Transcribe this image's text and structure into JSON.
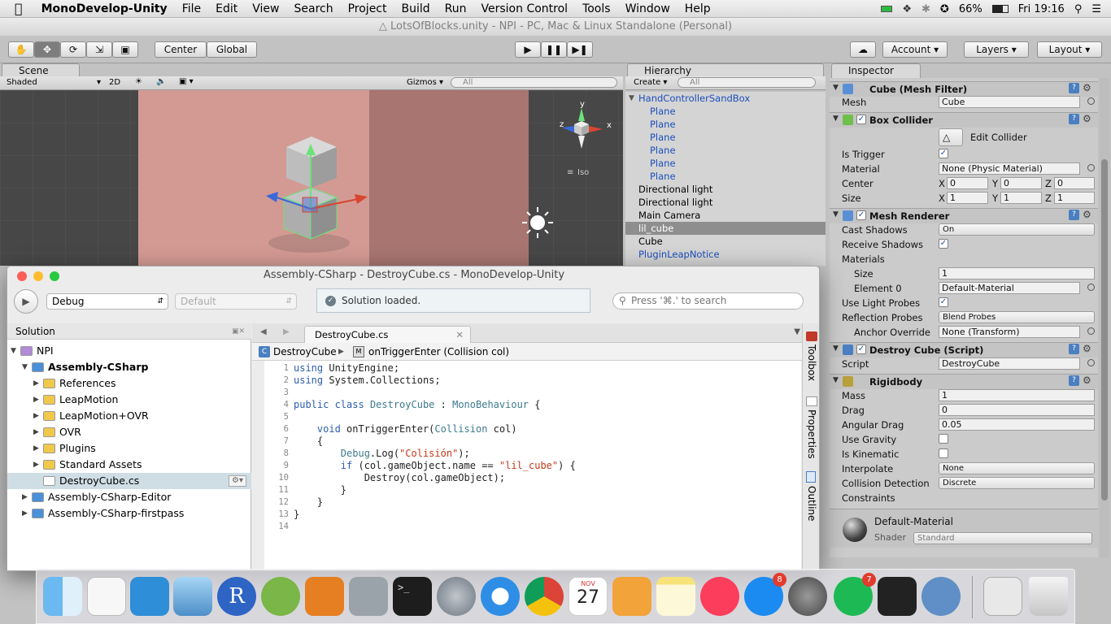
{
  "menubar": {
    "app_name": "MonoDevelop-Unity",
    "items": [
      "File",
      "Edit",
      "View",
      "Search",
      "Project",
      "Build",
      "Run",
      "Version Control",
      "Tools",
      "Window",
      "Help"
    ],
    "battery": "66%",
    "clock": "Fri 19:16"
  },
  "unity": {
    "window_title": "LotsOfBlocks.unity - NPI - PC, Mac & Linux Standalone (Personal)",
    "pivot_center": "Center",
    "pivot_global": "Global",
    "account": "Account",
    "layers": "Layers",
    "layout": "Layout",
    "scene_tab": "Scene",
    "scene_shading": "Shaded",
    "scene_2d": "2D",
    "gizmos": "Gizmos",
    "scene_search": "All",
    "iso_label": "Iso",
    "gizmo_axes": [
      "y",
      "x",
      "z"
    ],
    "hierarchy": {
      "tab": "Hierarchy",
      "create": "Create",
      "search": "All",
      "items": [
        {
          "label": "HandControllerSandBox",
          "indent": 0,
          "blue": true,
          "expanded": true
        },
        {
          "label": "Plane",
          "indent": 1,
          "blue": true
        },
        {
          "label": "Plane",
          "indent": 1,
          "blue": true
        },
        {
          "label": "Plane",
          "indent": 1,
          "blue": true
        },
        {
          "label": "Plane",
          "indent": 1,
          "blue": true
        },
        {
          "label": "Plane",
          "indent": 1,
          "blue": true
        },
        {
          "label": "Plane",
          "indent": 1,
          "blue": true
        },
        {
          "label": "Directional light",
          "indent": 0,
          "blue": false
        },
        {
          "label": "Directional light",
          "indent": 0,
          "blue": false
        },
        {
          "label": "Main Camera",
          "indent": 0,
          "blue": false
        },
        {
          "label": "lil_cube",
          "indent": 0,
          "blue": false,
          "selected": true
        },
        {
          "label": "Cube",
          "indent": 0,
          "blue": false
        },
        {
          "label": "PluginLeapNotice",
          "indent": 0,
          "blue": true
        }
      ]
    },
    "inspector": {
      "tab": "Inspector",
      "mesh_filter": {
        "title": "Cube (Mesh Filter)",
        "mesh_label": "Mesh",
        "mesh_value": "Cube"
      },
      "box_collider": {
        "title": "Box Collider",
        "edit_collider": "Edit Collider",
        "is_trigger_label": "Is Trigger",
        "is_trigger": true,
        "material_label": "Material",
        "material_value": "None (Physic Material)",
        "center_label": "Center",
        "center": {
          "x": "0",
          "y": "0",
          "z": "0"
        },
        "size_label": "Size",
        "size": {
          "x": "1",
          "y": "1",
          "z": "1"
        }
      },
      "mesh_renderer": {
        "title": "Mesh Renderer",
        "cast_shadows_label": "Cast Shadows",
        "cast_shadows": "On",
        "receive_shadows_label": "Receive Shadows",
        "receive_shadows": true,
        "materials_label": "Materials",
        "size_label": "Size",
        "size": "1",
        "element0_label": "Element 0",
        "element0": "Default-Material",
        "light_probes_label": "Use Light Probes",
        "light_probes": true,
        "reflection_probes_label": "Reflection Probes",
        "reflection_probes": "Blend Probes",
        "anchor_label": "Anchor Override",
        "anchor": "None (Transform)"
      },
      "script": {
        "title": "Destroy Cube (Script)",
        "script_label": "Script",
        "script_value": "DestroyCube"
      },
      "rigidbody": {
        "title": "Rigidbody",
        "mass_label": "Mass",
        "mass": "1",
        "drag_label": "Drag",
        "drag": "0",
        "angular_drag_label": "Angular Drag",
        "angular_drag": "0.05",
        "use_gravity_label": "Use Gravity",
        "use_gravity": false,
        "is_kinematic_label": "Is Kinematic",
        "is_kinematic": false,
        "interpolate_label": "Interpolate",
        "interpolate": "None",
        "collision_label": "Collision Detection",
        "collision": "Discrete",
        "constraints_label": "Constraints"
      },
      "material": {
        "name": "Default-Material",
        "shader_label": "Shader",
        "shader": "Standard"
      },
      "axis_labels": {
        "x": "X",
        "y": "Y",
        "z": "Z"
      }
    }
  },
  "monodevelop": {
    "title": "Assembly-CSharp - DestroyCube.cs - MonoDevelop-Unity",
    "config": "Debug",
    "platform": "Default",
    "status": "Solution loaded.",
    "search_placeholder": "Press '⌘.' to search",
    "solution_header": "Solution",
    "solution_tree": [
      {
        "label": "NPI",
        "indent": 0,
        "icon": "solution",
        "arrow": "down"
      },
      {
        "label": "Assembly-CSharp",
        "indent": 1,
        "icon": "project",
        "arrow": "down",
        "bold": true
      },
      {
        "label": "References",
        "indent": 2,
        "icon": "folder",
        "arrow": "right"
      },
      {
        "label": "LeapMotion",
        "indent": 2,
        "icon": "folder",
        "arrow": "right"
      },
      {
        "label": "LeapMotion+OVR",
        "indent": 2,
        "icon": "folder",
        "arrow": "right"
      },
      {
        "label": "OVR",
        "indent": 2,
        "icon": "folder",
        "arrow": "right"
      },
      {
        "label": "Plugins",
        "indent": 2,
        "icon": "folder",
        "arrow": "right"
      },
      {
        "label": "Standard Assets",
        "indent": 2,
        "icon": "folder",
        "arrow": "right"
      },
      {
        "label": "DestroyCube.cs",
        "indent": 2,
        "icon": "file",
        "arrow": "none",
        "selected": true
      },
      {
        "label": "Assembly-CSharp-Editor",
        "indent": 1,
        "icon": "project",
        "arrow": "right"
      },
      {
        "label": "Assembly-CSharp-firstpass",
        "indent": 1,
        "icon": "project",
        "arrow": "right"
      }
    ],
    "editor_tab": "DestroyCube.cs",
    "breadcrumb_class": "DestroyCube",
    "breadcrumb_method": "onTriggerEnter (Collision col)",
    "side_tabs": [
      "Toolbox",
      "Properties",
      "Document Outline"
    ],
    "code_lines": [
      [
        [
          "kw",
          "using"
        ],
        [
          "t",
          " UnityEngine;"
        ]
      ],
      [
        [
          "kw",
          "using"
        ],
        [
          "t",
          " System.Collections;"
        ]
      ],
      [],
      [
        [
          "kw",
          "public class"
        ],
        [
          "t",
          " "
        ],
        [
          "ty",
          "DestroyCube"
        ],
        [
          "t",
          " : "
        ],
        [
          "ty",
          "MonoBehaviour"
        ],
        [
          "t",
          " {"
        ]
      ],
      [],
      [
        [
          "t",
          "    "
        ],
        [
          "kw",
          "void"
        ],
        [
          "t",
          " onTriggerEnter("
        ],
        [
          "ty",
          "Collision"
        ],
        [
          "t",
          " col)"
        ]
      ],
      [
        [
          "t",
          "    {"
        ]
      ],
      [
        [
          "t",
          "        "
        ],
        [
          "ty",
          "Debug"
        ],
        [
          "t",
          ".Log("
        ],
        [
          "str",
          "\"Colisión\""
        ],
        [
          "t",
          ");"
        ]
      ],
      [
        [
          "t",
          "        "
        ],
        [
          "kw",
          "if"
        ],
        [
          "t",
          " (col.gameObject.name == "
        ],
        [
          "str",
          "\"lil_cube\""
        ],
        [
          "t",
          ") {"
        ]
      ],
      [
        [
          "t",
          "            Destroy(col.gameObject);"
        ]
      ],
      [
        [
          "t",
          "        }"
        ]
      ],
      [
        [
          "t",
          "    }"
        ]
      ],
      [
        [
          "t",
          "}"
        ]
      ],
      []
    ]
  },
  "dock": {
    "badges": {
      "appstore": "8",
      "spotify": "7"
    },
    "calendar_month": "NOV",
    "calendar_day": "27"
  }
}
